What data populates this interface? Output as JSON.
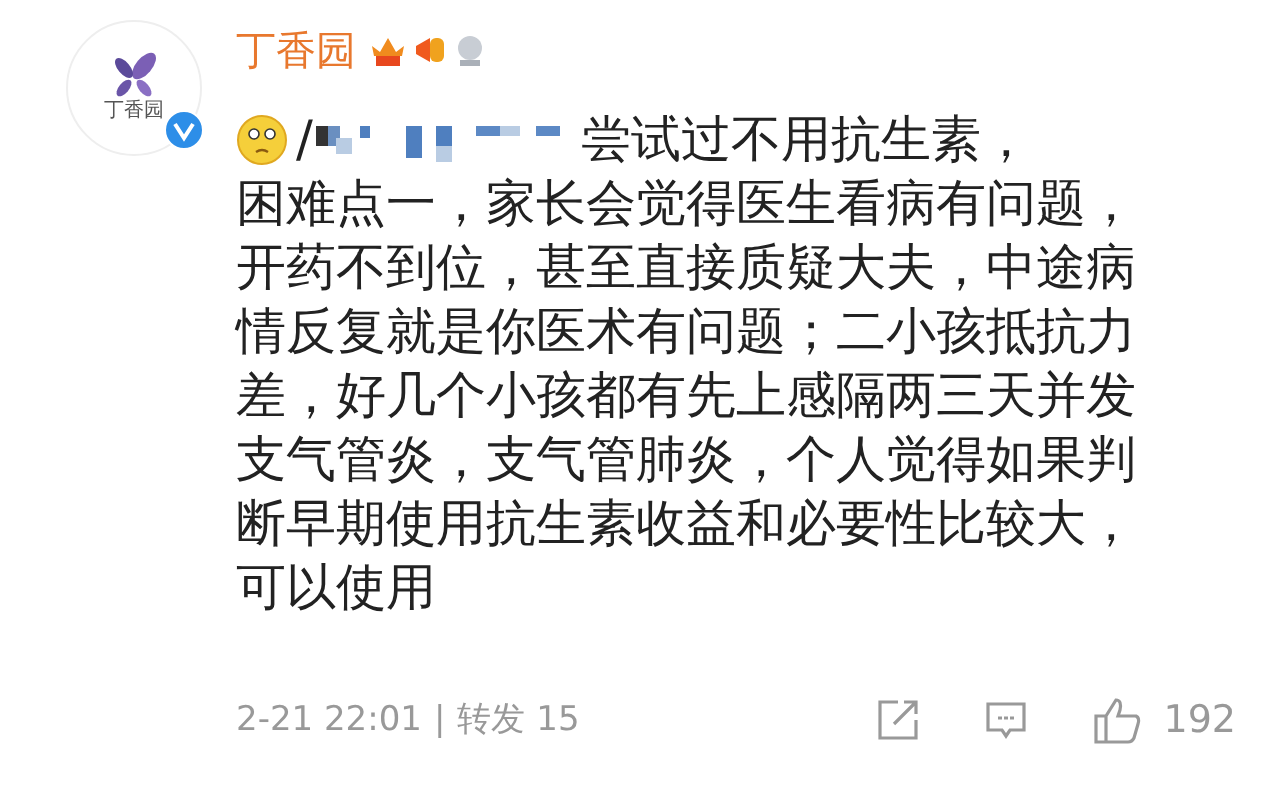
{
  "avatar": {
    "logo_text": "丁香园",
    "verified": true
  },
  "author": {
    "name": "丁香园"
  },
  "comment": {
    "mention_prefix": "/",
    "lines": [
      "尝试过不用抗生素，",
      "困难点一，家长会觉得医生看病有问题，",
      "开药不到位，甚至直接质疑大夫，中途病",
      "情反复就是你医术有问题；二小孩抵抗力",
      "差，好几个小孩都有先上感隔两三天并发",
      "支气管炎，支气管肺炎，个人觉得如果判",
      "断早期使用抗生素收益和必要性比较大，",
      "可以使用"
    ]
  },
  "footer": {
    "time": "2-21 22:01",
    "separator": "|",
    "repost": "转发 15",
    "likes": "192"
  }
}
